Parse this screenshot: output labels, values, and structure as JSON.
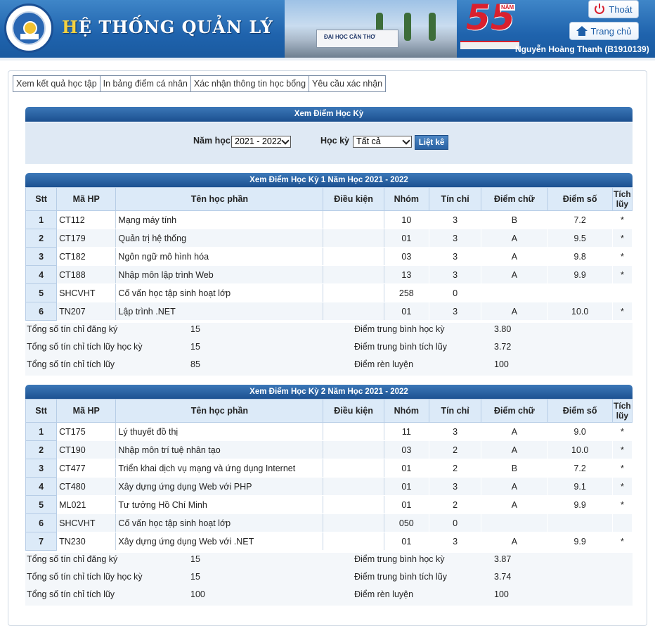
{
  "header": {
    "system_title_first": "H",
    "system_title_rest": "Ệ THỐNG QUẢN LÝ",
    "logo_text": "ĐẠI HỌC CẦN THƠ",
    "gate_text": "ĐẠI HỌC CẦN THƠ",
    "anniversary_number": "55",
    "anniversary_word": "NĂM",
    "user": "Nguyễn Hoàng Thanh (B1910139)",
    "logout_label": "Thoát",
    "home_label": "Trang chủ"
  },
  "tabs": [
    "Xem kết quả học tập",
    "In bảng điểm cá nhân",
    "Xác nhận thông tin học bổng",
    "Yêu cầu xác nhận"
  ],
  "filter": {
    "title": "Xem Điểm Học Kỳ",
    "year_label": "Năm học",
    "year_value": "2021 - 2022",
    "semester_label": "Học kỳ",
    "semester_value": "Tất cả",
    "list_button": "Liệt kê"
  },
  "columns": [
    "Stt",
    "Mã HP",
    "Tên học phần",
    "Điều kiện",
    "Nhóm",
    "Tín chỉ",
    "Điểm chữ",
    "Điểm số",
    "Tích lũy"
  ],
  "summary_labels": {
    "registered": "Tổng số tín chỉ đăng ký",
    "accumulated_term": "Tổng số tín chỉ tích lũy học kỳ",
    "accumulated": "Tổng số tín chỉ tích lũy",
    "gpa_term": "Điểm trung bình học kỳ",
    "gpa_cumulative": "Điểm trung bình tích lũy",
    "conduct": "Điểm rèn luyện"
  },
  "semesters": [
    {
      "title": "Xem Điểm Học Kỳ 1 Năm Học 2021 - 2022",
      "rows": [
        {
          "stt": "1",
          "code": "CT112",
          "name": "Mạng máy tính",
          "cond": "",
          "group": "10",
          "credits": "3",
          "letter": "B",
          "score": "7.2",
          "acc": "*"
        },
        {
          "stt": "2",
          "code": "CT179",
          "name": "Quản trị hệ thống",
          "cond": "",
          "group": "01",
          "credits": "3",
          "letter": "A",
          "score": "9.5",
          "acc": "*"
        },
        {
          "stt": "3",
          "code": "CT182",
          "name": "Ngôn ngữ mô hình hóa",
          "cond": "",
          "group": "03",
          "credits": "3",
          "letter": "A",
          "score": "9.8",
          "acc": "*"
        },
        {
          "stt": "4",
          "code": "CT188",
          "name": "Nhập môn lập trình Web",
          "cond": "",
          "group": "13",
          "credits": "3",
          "letter": "A",
          "score": "9.9",
          "acc": "*"
        },
        {
          "stt": "5",
          "code": "SHCVHT",
          "name": "Cố vấn học tập sinh hoạt lớp",
          "cond": "",
          "group": "258",
          "credits": "0",
          "letter": "",
          "score": "",
          "acc": ""
        },
        {
          "stt": "6",
          "code": "TN207",
          "name": "Lập trình .NET",
          "cond": "",
          "group": "01",
          "credits": "3",
          "letter": "A",
          "score": "10.0",
          "acc": "*"
        }
      ],
      "summary": {
        "registered": "15",
        "accumulated_term": "15",
        "accumulated": "85",
        "gpa_term": "3.80",
        "gpa_cumulative": "3.72",
        "conduct": "100"
      }
    },
    {
      "title": "Xem Điểm Học Kỳ 2 Năm Học 2021 - 2022",
      "rows": [
        {
          "stt": "1",
          "code": "CT175",
          "name": "Lý thuyết đồ thị",
          "cond": "",
          "group": "11",
          "credits": "3",
          "letter": "A",
          "score": "9.0",
          "acc": "*"
        },
        {
          "stt": "2",
          "code": "CT190",
          "name": "Nhập môn trí tuệ nhân tạo",
          "cond": "",
          "group": "03",
          "credits": "2",
          "letter": "A",
          "score": "10.0",
          "acc": "*"
        },
        {
          "stt": "3",
          "code": "CT477",
          "name": "Triển khai dịch vụ mạng và ứng dụng Internet",
          "cond": "",
          "group": "01",
          "credits": "2",
          "letter": "B",
          "score": "7.2",
          "acc": "*"
        },
        {
          "stt": "4",
          "code": "CT480",
          "name": "Xây dựng ứng dụng Web với PHP",
          "cond": "",
          "group": "01",
          "credits": "3",
          "letter": "A",
          "score": "9.1",
          "acc": "*"
        },
        {
          "stt": "5",
          "code": "ML021",
          "name": "Tư tưởng Hồ Chí Minh",
          "cond": "",
          "group": "01",
          "credits": "2",
          "letter": "A",
          "score": "9.9",
          "acc": "*"
        },
        {
          "stt": "6",
          "code": "SHCVHT",
          "name": "Cố vấn học tập sinh hoạt lớp",
          "cond": "",
          "group": "050",
          "credits": "0",
          "letter": "",
          "score": "",
          "acc": ""
        },
        {
          "stt": "7",
          "code": "TN230",
          "name": "Xây dựng ứng dụng Web với .NET",
          "cond": "",
          "group": "01",
          "credits": "3",
          "letter": "A",
          "score": "9.9",
          "acc": "*"
        }
      ],
      "summary": {
        "registered": "15",
        "accumulated_term": "15",
        "accumulated": "100",
        "gpa_term": "3.87",
        "gpa_cumulative": "3.74",
        "conduct": "100"
      }
    }
  ]
}
